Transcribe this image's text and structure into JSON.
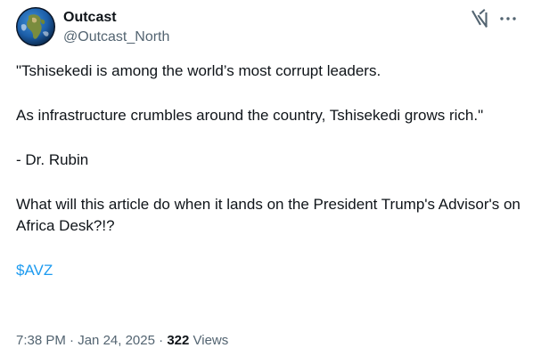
{
  "author": {
    "display_name": "Outcast",
    "handle": "@Outcast_North"
  },
  "icons": {
    "avatar": "earth-globe-avatar",
    "grok": "grok-icon",
    "more": "more-icon"
  },
  "tweet": {
    "paragraphs": [
      "\"Tshisekedi is among the world’s most corrupt leaders.",
      "As infrastructure crumbles around the country, Tshisekedi grows rich.\"",
      "- Dr. Rubin",
      "What will this article do when it lands on the President Trump's Advisor's on Africa Desk?!?"
    ],
    "cashtag": "$AVZ"
  },
  "meta": {
    "time": "7:38 PM",
    "separator": "·",
    "date": "Jan 24, 2025",
    "views_count": "322",
    "views_label": "Views"
  },
  "colors": {
    "text": "#0f1419",
    "secondary": "#536471",
    "link": "#1d9bf0"
  }
}
